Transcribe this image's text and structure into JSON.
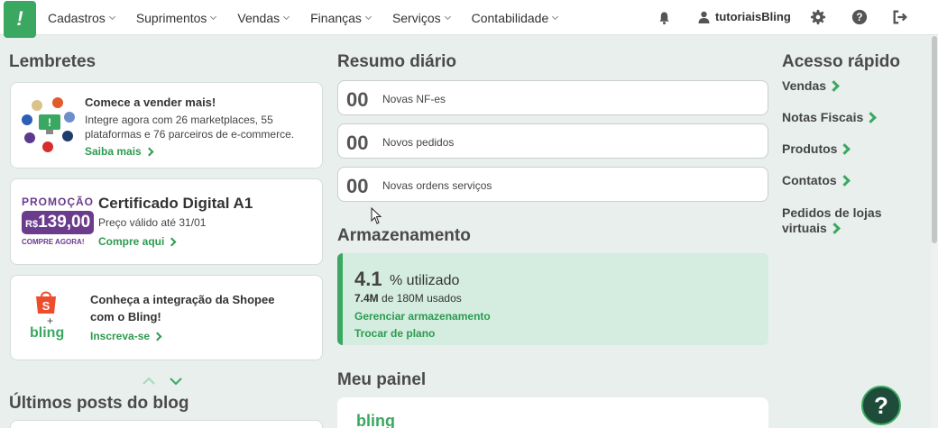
{
  "nav": {
    "logo": "!",
    "menu": [
      "Cadastros",
      "Suprimentos",
      "Vendas",
      "Finanças",
      "Serviços",
      "Contabilidade"
    ],
    "user": "tutoriaisBling"
  },
  "reminders": {
    "title": "Lembretes",
    "marketplaces": {
      "title": "Comece a vender mais!",
      "text_line1": "Integre agora com 26 marketplaces, 55",
      "text_line2": "plataformas e 76 parceiros de e-commerce.",
      "link": "Saiba mais"
    },
    "promo": {
      "tag": "PROMOÇÃO",
      "currency": "R$",
      "price": "139,00",
      "buy": "COMPRE AGORA!",
      "title": "Certificado Digital A1",
      "subtitle": "Preço válido até 31/01",
      "link": "Compre aqui"
    },
    "shopee": {
      "title_line1": "Conheça a integração da Shopee",
      "title_line2": "com o Bling!",
      "link": "Inscreva-se",
      "shopee_letter": "S",
      "plus": "+",
      "bling_logo": "bling"
    }
  },
  "blog": {
    "title": "Últimos posts do blog"
  },
  "summary": {
    "title": "Resumo diário",
    "items": [
      {
        "value": "00",
        "label": "Novas NF-es"
      },
      {
        "value": "00",
        "label": "Novos pedidos"
      },
      {
        "value": "00",
        "label": "Novas ordens serviços"
      }
    ]
  },
  "storage": {
    "title": "Armazenamento",
    "percent": "4.1",
    "percent_label": "% utilizado",
    "used": "7.4M",
    "used_rest": "de 180M usados",
    "manage": "Gerenciar armazenamento",
    "change_plan": "Trocar de plano"
  },
  "panel": {
    "title": "Meu painel",
    "logo": "bling"
  },
  "quick_access": {
    "title": "Acesso rápido",
    "items": [
      "Vendas",
      "Notas Fiscais",
      "Produtos",
      "Contatos"
    ],
    "last_line1": "Pedidos de lojas",
    "last_line2": "virtuais"
  },
  "help": "?",
  "colors": {
    "accent": "#3aa860",
    "promo": "#6b3b8c",
    "storage_bg": "#d4ede0"
  }
}
